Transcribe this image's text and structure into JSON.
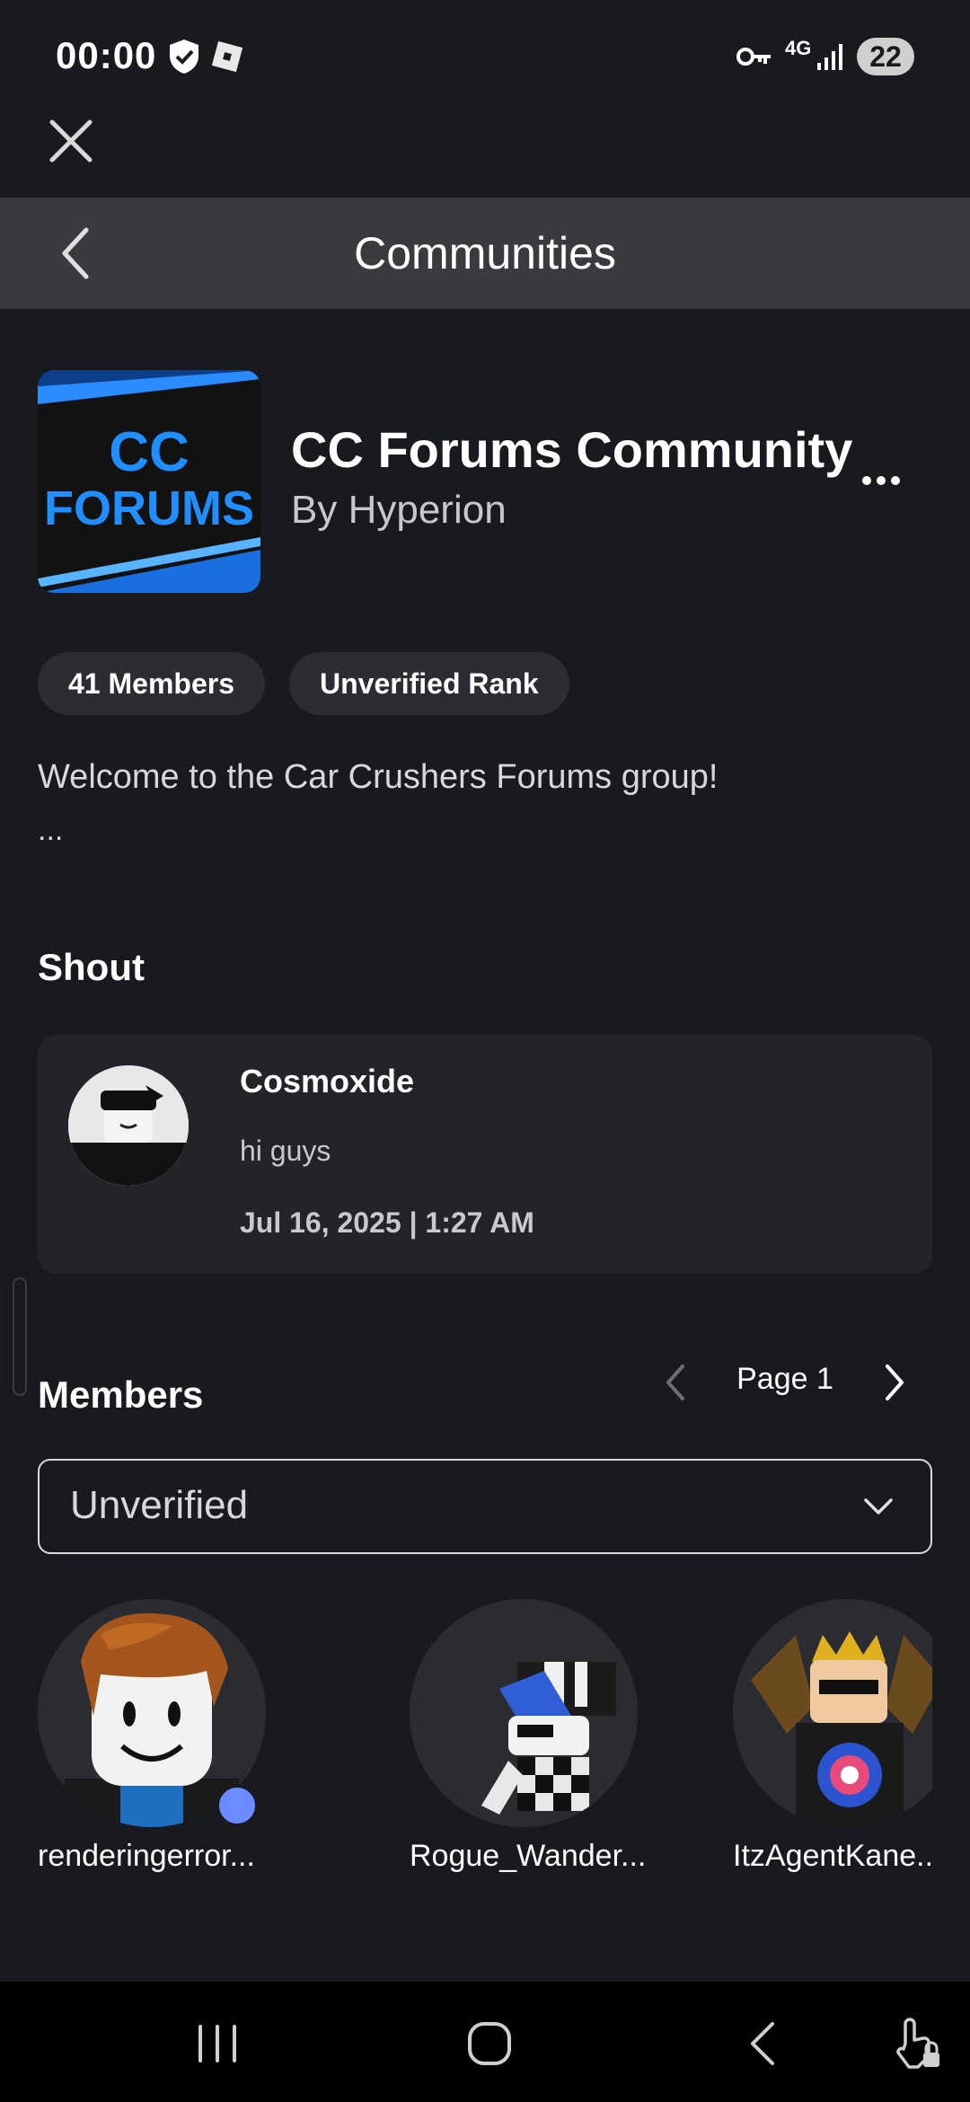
{
  "status_bar": {
    "time": "00:00",
    "network_label": "4G",
    "battery": "22"
  },
  "header": {
    "title": "Communities"
  },
  "community": {
    "name": "CC Forums Community",
    "owner": "By Hyperion",
    "logo_text_top": "CC",
    "logo_text_bottom": "FORUMS",
    "members_pill": "41 Members",
    "rank_pill": "Unverified Rank",
    "description": "Welcome to the Car Crushers Forums group!",
    "description_more": "..."
  },
  "shout": {
    "heading": "Shout",
    "author": "Cosmoxide",
    "message": "hi guys",
    "date": "Jul 16, 2025 | 1:27 AM"
  },
  "members": {
    "heading": "Members",
    "page_label": "Page 1",
    "role_filter": "Unverified",
    "list": [
      {
        "name": "renderingerror...",
        "online": true
      },
      {
        "name": "Rogue_Wander...",
        "online": false
      },
      {
        "name": "ItzAgentKane...",
        "online": false
      }
    ]
  },
  "colors": {
    "background": "#191a1f",
    "header": "#3a3b3f",
    "card": "#232429",
    "pill": "#2c2d33",
    "online": "#6b8cff",
    "logo_accent": "#1f8fff"
  },
  "icons": [
    "shield-icon",
    "roblox-icon",
    "key-icon",
    "signal-icon",
    "close-icon",
    "back-arrow-icon",
    "more-icon",
    "chevron-left-icon",
    "chevron-right-icon",
    "chevron-down-icon",
    "recents-icon",
    "home-icon",
    "nav-back-icon",
    "accessibility-icon"
  ]
}
